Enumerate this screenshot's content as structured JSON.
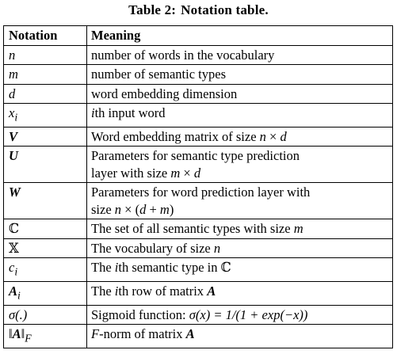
{
  "caption": {
    "label": "Table 2:",
    "title": "Notation table."
  },
  "columns": {
    "notation": "Notation",
    "meaning": "Meaning"
  },
  "rows": [
    {
      "symbol": "n",
      "meaning": "number of words in the vocabulary"
    },
    {
      "symbol": "m",
      "meaning": "number of semantic types"
    },
    {
      "symbol": "d",
      "meaning": "word embedding dimension"
    },
    {
      "symbol": "xi",
      "meaning_pre": "i",
      "meaning": "th input word"
    },
    {
      "symbol": "V",
      "meaning": "Word embedding matrix of size n × d"
    },
    {
      "symbol": "U",
      "meaning": "Parameters for semantic type prediction layer with size m × d"
    },
    {
      "symbol": "W",
      "meaning": "Parameters for word prediction layer with size n × (d + m)"
    },
    {
      "symbol": "ℂ",
      "meaning": "The set of all semantic types with size m"
    },
    {
      "symbol": "𝕏",
      "meaning": "The vocabulary of size n"
    },
    {
      "symbol": "ci",
      "meaning": "The ith semantic type in ℂ"
    },
    {
      "symbol": "Ai",
      "meaning": "The ith row of matrix A"
    },
    {
      "symbol": "σ(.)",
      "meaning": "Sigmoid function: σ(x) = 1/(1 + exp(−x))"
    },
    {
      "symbol": "‖A‖F",
      "meaning": "F-norm of matrix A"
    }
  ],
  "text": {
    "r1_sym": "n",
    "r1_mean": "number of words in the vocabulary",
    "r2_sym": "m",
    "r2_mean": "number of semantic types",
    "r3_sym": "d",
    "r3_mean": "word embedding dimension",
    "r4_sym_base": "x",
    "r4_sym_sub": "i",
    "r4_mean_i": "i",
    "r4_mean": "th input word",
    "r5_sym": "V",
    "r5_mean_a": "Word embedding matrix of size ",
    "r5_n": "n",
    "r5_times": " × ",
    "r5_d": "d",
    "r6_sym": "U",
    "r6_mean_line1": "Parameters for semantic type prediction",
    "r6_mean_a": "layer with size ",
    "r6_m": "m",
    "r6_times": " × ",
    "r6_d": "d",
    "r7_sym": "W",
    "r7_mean_line1": "Parameters for word prediction layer with",
    "r7_mean_a": "size ",
    "r7_n": "n",
    "r7_times": " × (",
    "r7_d": "d",
    "r7_plus": " + ",
    "r7_m": "m",
    "r7_close": ")",
    "r8_sym": "ℂ",
    "r8_mean_a": "The set of all semantic types with size ",
    "r8_m": "m",
    "r9_sym": "𝕏",
    "r9_mean_a": "The vocabulary of size ",
    "r9_n": "n",
    "r10_sym_base": "c",
    "r10_sym_sub": "i",
    "r10_mean_a": "The ",
    "r10_i": "i",
    "r10_mean_b": "th semantic type in ",
    "r10_C": "ℂ",
    "r11_sym_base": "A",
    "r11_sym_sub": "i",
    "r11_mean_a": "The ",
    "r11_i": "i",
    "r11_mean_b": "th row of matrix ",
    "r11_A": "A",
    "r12_sym": "σ(.)",
    "r12_mean_a": "Sigmoid function: ",
    "r12_formula": "σ(x) = 1/(1 + exp(−x))",
    "r13_sym_pre": "‖",
    "r13_sym_A": "A",
    "r13_sym_post": "‖",
    "r13_sym_sub": "F",
    "r13_F": "F",
    "r13_mean_b": "-norm of matrix ",
    "r13_A": "A"
  }
}
